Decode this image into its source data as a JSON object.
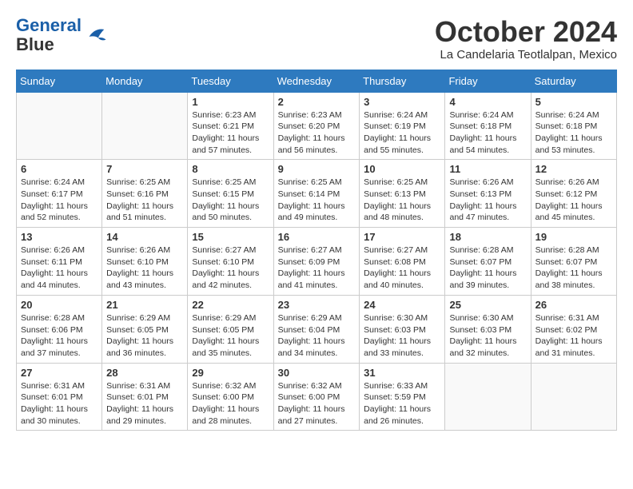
{
  "header": {
    "logo_line1": "General",
    "logo_line2": "Blue",
    "month": "October 2024",
    "location": "La Candelaria Teotlalpan, Mexico"
  },
  "weekdays": [
    "Sunday",
    "Monday",
    "Tuesday",
    "Wednesday",
    "Thursday",
    "Friday",
    "Saturday"
  ],
  "weeks": [
    [
      {
        "day": "",
        "info": ""
      },
      {
        "day": "",
        "info": ""
      },
      {
        "day": "1",
        "info": "Sunrise: 6:23 AM\nSunset: 6:21 PM\nDaylight: 11 hours and 57 minutes."
      },
      {
        "day": "2",
        "info": "Sunrise: 6:23 AM\nSunset: 6:20 PM\nDaylight: 11 hours and 56 minutes."
      },
      {
        "day": "3",
        "info": "Sunrise: 6:24 AM\nSunset: 6:19 PM\nDaylight: 11 hours and 55 minutes."
      },
      {
        "day": "4",
        "info": "Sunrise: 6:24 AM\nSunset: 6:18 PM\nDaylight: 11 hours and 54 minutes."
      },
      {
        "day": "5",
        "info": "Sunrise: 6:24 AM\nSunset: 6:18 PM\nDaylight: 11 hours and 53 minutes."
      }
    ],
    [
      {
        "day": "6",
        "info": "Sunrise: 6:24 AM\nSunset: 6:17 PM\nDaylight: 11 hours and 52 minutes."
      },
      {
        "day": "7",
        "info": "Sunrise: 6:25 AM\nSunset: 6:16 PM\nDaylight: 11 hours and 51 minutes."
      },
      {
        "day": "8",
        "info": "Sunrise: 6:25 AM\nSunset: 6:15 PM\nDaylight: 11 hours and 50 minutes."
      },
      {
        "day": "9",
        "info": "Sunrise: 6:25 AM\nSunset: 6:14 PM\nDaylight: 11 hours and 49 minutes."
      },
      {
        "day": "10",
        "info": "Sunrise: 6:25 AM\nSunset: 6:13 PM\nDaylight: 11 hours and 48 minutes."
      },
      {
        "day": "11",
        "info": "Sunrise: 6:26 AM\nSunset: 6:13 PM\nDaylight: 11 hours and 47 minutes."
      },
      {
        "day": "12",
        "info": "Sunrise: 6:26 AM\nSunset: 6:12 PM\nDaylight: 11 hours and 45 minutes."
      }
    ],
    [
      {
        "day": "13",
        "info": "Sunrise: 6:26 AM\nSunset: 6:11 PM\nDaylight: 11 hours and 44 minutes."
      },
      {
        "day": "14",
        "info": "Sunrise: 6:26 AM\nSunset: 6:10 PM\nDaylight: 11 hours and 43 minutes."
      },
      {
        "day": "15",
        "info": "Sunrise: 6:27 AM\nSunset: 6:10 PM\nDaylight: 11 hours and 42 minutes."
      },
      {
        "day": "16",
        "info": "Sunrise: 6:27 AM\nSunset: 6:09 PM\nDaylight: 11 hours and 41 minutes."
      },
      {
        "day": "17",
        "info": "Sunrise: 6:27 AM\nSunset: 6:08 PM\nDaylight: 11 hours and 40 minutes."
      },
      {
        "day": "18",
        "info": "Sunrise: 6:28 AM\nSunset: 6:07 PM\nDaylight: 11 hours and 39 minutes."
      },
      {
        "day": "19",
        "info": "Sunrise: 6:28 AM\nSunset: 6:07 PM\nDaylight: 11 hours and 38 minutes."
      }
    ],
    [
      {
        "day": "20",
        "info": "Sunrise: 6:28 AM\nSunset: 6:06 PM\nDaylight: 11 hours and 37 minutes."
      },
      {
        "day": "21",
        "info": "Sunrise: 6:29 AM\nSunset: 6:05 PM\nDaylight: 11 hours and 36 minutes."
      },
      {
        "day": "22",
        "info": "Sunrise: 6:29 AM\nSunset: 6:05 PM\nDaylight: 11 hours and 35 minutes."
      },
      {
        "day": "23",
        "info": "Sunrise: 6:29 AM\nSunset: 6:04 PM\nDaylight: 11 hours and 34 minutes."
      },
      {
        "day": "24",
        "info": "Sunrise: 6:30 AM\nSunset: 6:03 PM\nDaylight: 11 hours and 33 minutes."
      },
      {
        "day": "25",
        "info": "Sunrise: 6:30 AM\nSunset: 6:03 PM\nDaylight: 11 hours and 32 minutes."
      },
      {
        "day": "26",
        "info": "Sunrise: 6:31 AM\nSunset: 6:02 PM\nDaylight: 11 hours and 31 minutes."
      }
    ],
    [
      {
        "day": "27",
        "info": "Sunrise: 6:31 AM\nSunset: 6:01 PM\nDaylight: 11 hours and 30 minutes."
      },
      {
        "day": "28",
        "info": "Sunrise: 6:31 AM\nSunset: 6:01 PM\nDaylight: 11 hours and 29 minutes."
      },
      {
        "day": "29",
        "info": "Sunrise: 6:32 AM\nSunset: 6:00 PM\nDaylight: 11 hours and 28 minutes."
      },
      {
        "day": "30",
        "info": "Sunrise: 6:32 AM\nSunset: 6:00 PM\nDaylight: 11 hours and 27 minutes."
      },
      {
        "day": "31",
        "info": "Sunrise: 6:33 AM\nSunset: 5:59 PM\nDaylight: 11 hours and 26 minutes."
      },
      {
        "day": "",
        "info": ""
      },
      {
        "day": "",
        "info": ""
      }
    ]
  ]
}
